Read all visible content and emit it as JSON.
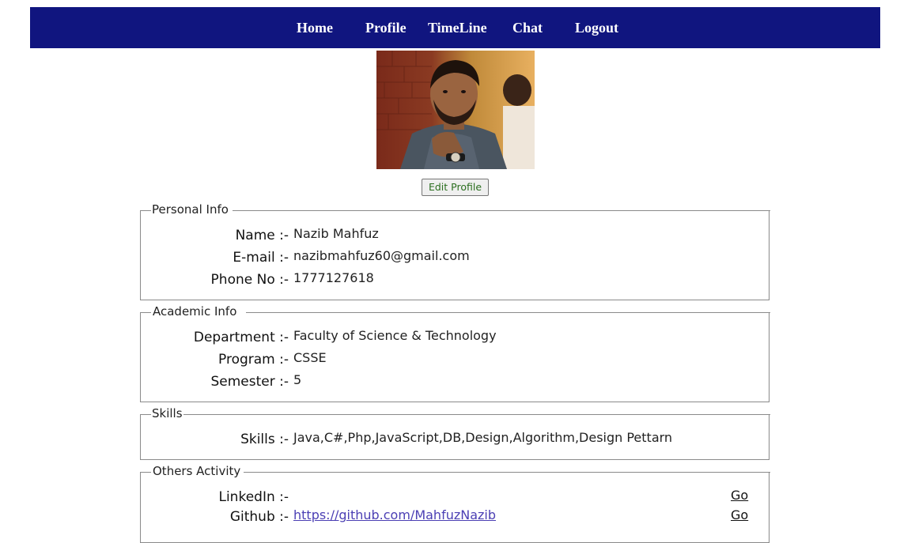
{
  "nav": {
    "items": [
      {
        "label": "Home"
      },
      {
        "label": "Profile"
      },
      {
        "label": "TimeLine"
      },
      {
        "label": "Chat"
      },
      {
        "label": "Logout"
      }
    ]
  },
  "profile": {
    "edit_button_label": "Edit Profile"
  },
  "personal_info": {
    "legend": "Personal Info",
    "name_label": "Name :-",
    "name_value": "Nazib Mahfuz",
    "email_label": "E-mail :-",
    "email_value": "nazibmahfuz60@gmail.com",
    "phone_label": "Phone No :-",
    "phone_value": "1777127618"
  },
  "academic_info": {
    "legend": "Academic Info",
    "department_label": "Department :-",
    "department_value": "Faculty of Science & Technology",
    "program_label": "Program :-",
    "program_value": "CSSE",
    "semester_label": "Semester :-",
    "semester_value": "5"
  },
  "skills": {
    "legend": "Skills",
    "skills_label": "Skills :-",
    "skills_value": "Java,C#,Php,JavaScript,DB,Design,Algorithm,Design Pettarn"
  },
  "others_activity": {
    "legend": "Others Activity",
    "linkedin_label": "LinkedIn :-",
    "linkedin_value": "",
    "linkedin_go": "Go",
    "github_label": "Github :-",
    "github_value": "https://github.com/MahfuzNazib",
    "github_go": "Go"
  },
  "colors": {
    "navbar_bg": "#10157f",
    "nav_text": "#ffffff",
    "border": "#8a8a8a",
    "link": "#4b3fb4"
  }
}
